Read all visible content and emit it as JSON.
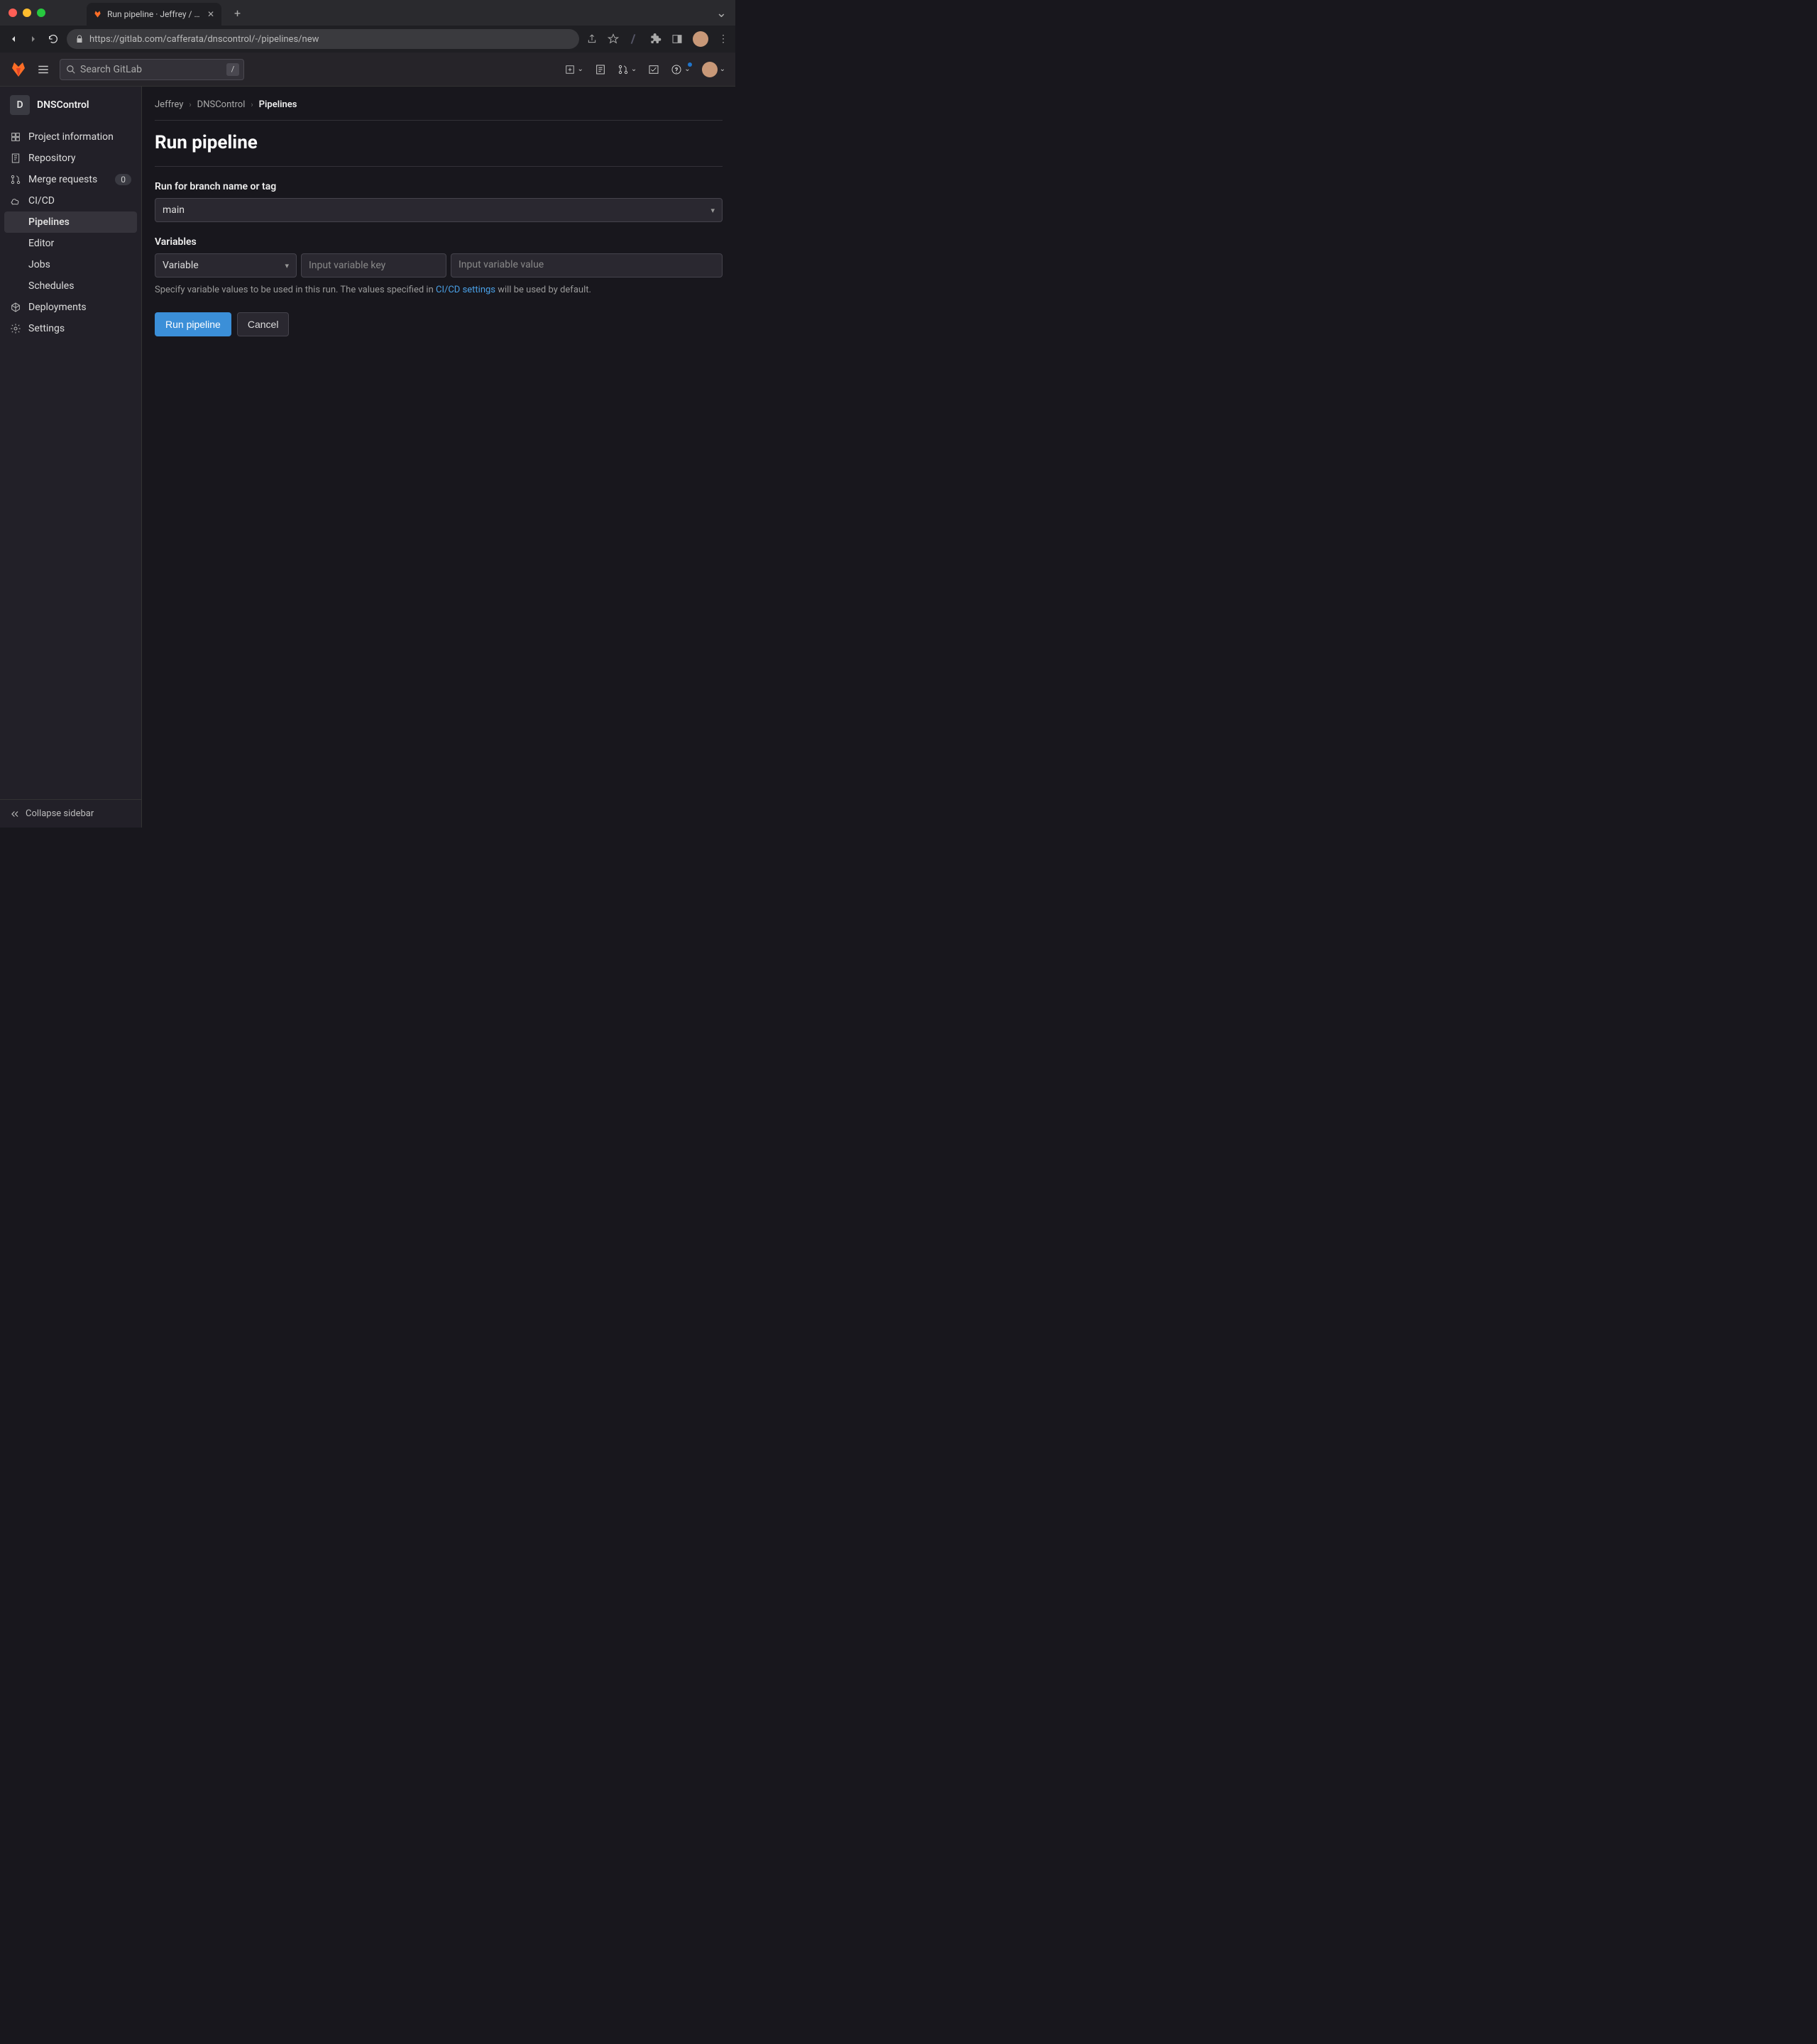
{
  "browser": {
    "tab_title": "Run pipeline · Jeffrey / DNSCo…",
    "url": "https://gitlab.com/cafferata/dnscontrol/-/pipelines/new"
  },
  "topbar": {
    "search_placeholder": "Search GitLab",
    "search_shortcut": "/"
  },
  "sidebar": {
    "project_initial": "D",
    "project_name": "DNSControl",
    "items": [
      {
        "label": "Project information"
      },
      {
        "label": "Repository"
      },
      {
        "label": "Merge requests",
        "count": "0"
      },
      {
        "label": "CI/CD"
      }
    ],
    "ci_sub": [
      {
        "label": "Pipelines"
      },
      {
        "label": "Editor"
      },
      {
        "label": "Jobs"
      },
      {
        "label": "Schedules"
      }
    ],
    "items2": [
      {
        "label": "Deployments"
      },
      {
        "label": "Settings"
      }
    ],
    "collapse_label": "Collapse sidebar"
  },
  "breadcrumb": {
    "items": [
      "Jeffrey",
      "DNSControl"
    ],
    "current": "Pipelines"
  },
  "page": {
    "title": "Run pipeline",
    "branch_label": "Run for branch name or tag",
    "branch_value": "main",
    "variables_label": "Variables",
    "var_type_value": "Variable",
    "var_key_placeholder": "Input variable key",
    "var_value_placeholder": "Input variable value",
    "help_text_pre": "Specify variable values to be used in this run. The values specified in ",
    "help_link": "CI/CD settings",
    "help_text_post": " will be used by default.",
    "run_button": "Run pipeline",
    "cancel_button": "Cancel"
  }
}
